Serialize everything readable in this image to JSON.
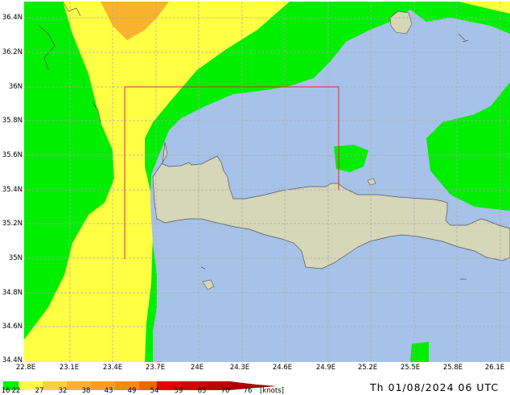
{
  "map": {
    "lat_labels": [
      "36.4N",
      "36.2N",
      "36N",
      "35.8N",
      "35.6N",
      "35.4N",
      "35.2N",
      "35N",
      "34.8N",
      "34.6N",
      "34.4N"
    ],
    "lon_labels": [
      "22.8E",
      "23.1E",
      "23.4E",
      "23.7E",
      "24E",
      "24.3E",
      "24.6E",
      "24.9E",
      "25.2E",
      "25.5E",
      "25.8E",
      "26.1E"
    ],
    "colors": {
      "sea": "#a6c2e8",
      "land": "#d6d6b8",
      "wind_16_22": "#00ee00",
      "wind_22_27": "#ffff44",
      "wind_27_32": "#fcd23c",
      "wind_32_36": "#f9b32e",
      "grid": "#aaaaaa",
      "box": "#cc3333"
    }
  },
  "legend": {
    "values": [
      "16",
      "22",
      "27",
      "32",
      "38",
      "43",
      "49",
      "54",
      "59",
      "65",
      "70",
      "76"
    ],
    "units": "[knots]",
    "colors": [
      "#00ee00",
      "#ffff44",
      "#fcd23c",
      "#f9b32e",
      "#f6a01e",
      "#f08c0c",
      "#ee6600",
      "#e60000",
      "#d20000",
      "#c00000",
      "#aa0000"
    ]
  },
  "timestamp": "Th 01/08/2024 06 UTC"
}
